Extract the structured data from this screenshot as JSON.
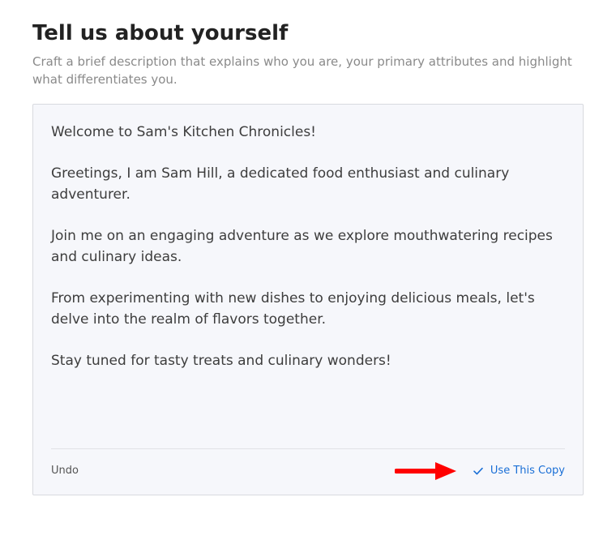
{
  "header": {
    "title": "Tell us about yourself",
    "subtitle": "Craft a brief description that explains who you are, your primary attributes and highlight what differentiates you."
  },
  "editor": {
    "paragraphs": [
      "Welcome to Sam's Kitchen Chronicles!",
      "Greetings, I am Sam Hill, a dedicated food enthusiast and culinary adventurer.",
      "Join me on an engaging adventure as we explore mouthwatering recipes and culinary ideas.",
      "From experimenting with new dishes to enjoying delicious meals, let's delve into the realm of flavors together.",
      "Stay tuned for tasty treats and culinary wonders!"
    ]
  },
  "footer": {
    "undo_label": "Undo",
    "use_copy_label": "Use This Copy"
  },
  "annotation": {
    "arrow_color": "#ff0000"
  },
  "colors": {
    "link": "#1a6fd6",
    "panel_bg": "#f6f7fb",
    "border": "#d8dadf"
  }
}
